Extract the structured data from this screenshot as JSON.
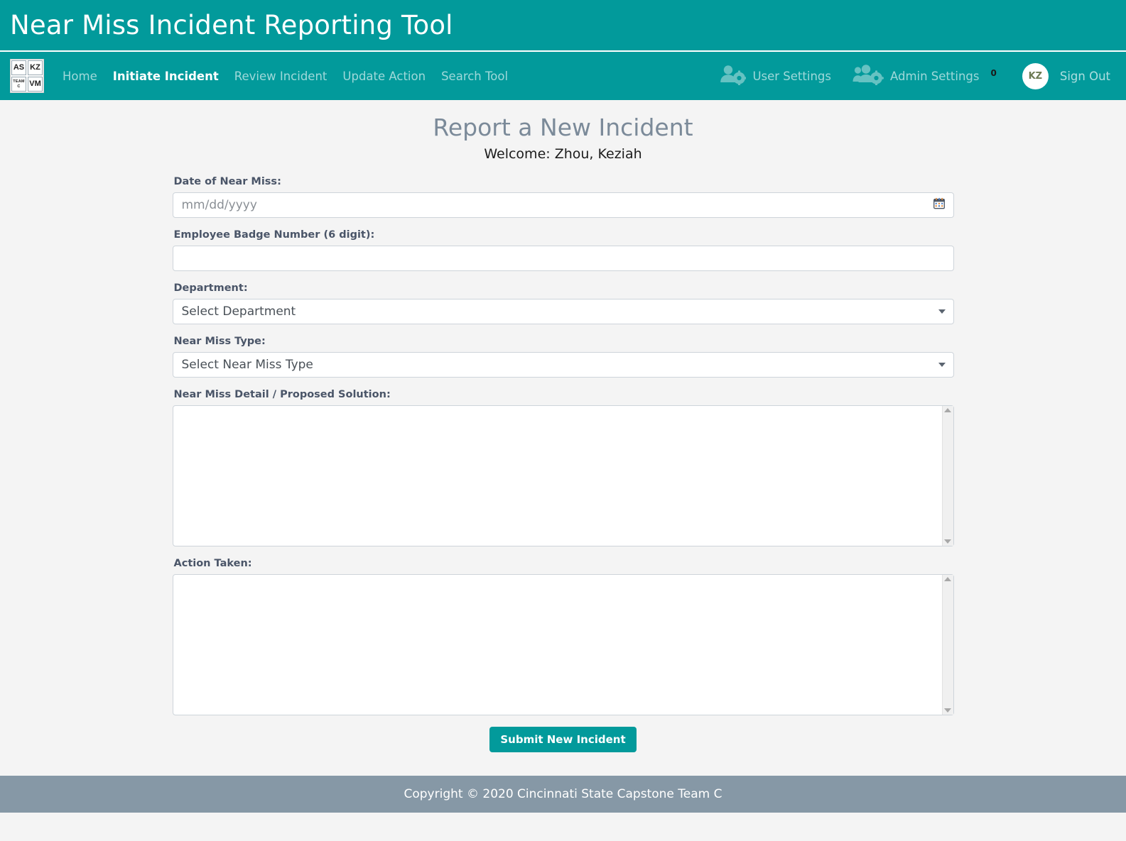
{
  "app": {
    "title": "Near Miss Incident Reporting Tool",
    "accent_color": "#029a9b",
    "footer_color": "#8698a6",
    "title_text_color": "#7b8a99"
  },
  "logo": {
    "cell_tl": "AS",
    "cell_tr": "KZ",
    "cell_bl_line1": "TEAM",
    "cell_bl_line2": "C",
    "cell_br": "VM"
  },
  "nav": {
    "items": [
      {
        "label": "Home",
        "active": false
      },
      {
        "label": "Initiate Incident",
        "active": true
      },
      {
        "label": "Review Incident",
        "active": false
      },
      {
        "label": "Update Action",
        "active": false
      },
      {
        "label": "Search Tool",
        "active": false
      }
    ],
    "user_settings_label": "User Settings",
    "user_settings_icon": "user-gear-icon",
    "admin_settings_label": "Admin Settings",
    "admin_settings_icon": "users-gear-icon",
    "notification_count": "0",
    "avatar_initials": "KZ",
    "sign_out_label": "Sign Out"
  },
  "page": {
    "heading": "Report a New Incident",
    "welcome": "Welcome: Zhou, Keziah"
  },
  "form": {
    "date": {
      "label": "Date of Near Miss:",
      "value": "",
      "placeholder": "mm/dd/yyyy",
      "icon": "calendar-icon"
    },
    "badge": {
      "label": "Employee Badge Number (6 digit):",
      "value": "",
      "placeholder": ""
    },
    "department": {
      "label": "Department:",
      "selected": "Select Department",
      "options": [
        "Select Department"
      ]
    },
    "near_miss_type": {
      "label": "Near Miss Type:",
      "selected": "Select Near Miss Type",
      "options": [
        "Select Near Miss Type"
      ]
    },
    "detail": {
      "label": "Near Miss Detail / Proposed Solution:",
      "value": "",
      "placeholder": ""
    },
    "action_taken": {
      "label": "Action Taken:",
      "value": "",
      "placeholder": ""
    },
    "submit_label": "Submit New Incident"
  },
  "footer": {
    "copyright": "Copyright © 2020 Cincinnati State Capstone Team C"
  }
}
